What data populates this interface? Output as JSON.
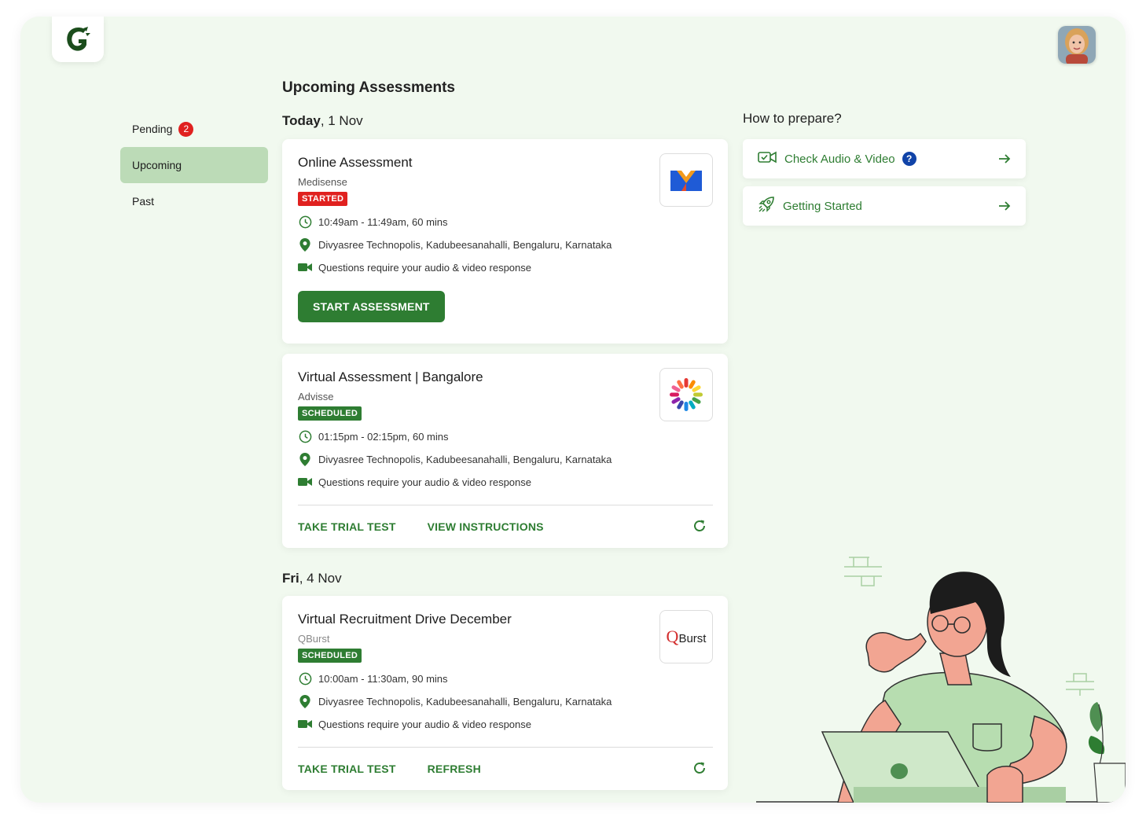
{
  "header": {
    "logo_icon": "crocodile-logo-icon",
    "avatar_icon": "user-avatar"
  },
  "sidebar": {
    "items": [
      {
        "label": "Pending",
        "badge": "2"
      },
      {
        "label": "Upcoming"
      },
      {
        "label": "Past"
      }
    ]
  },
  "main": {
    "title": "Upcoming Assessments",
    "groups": [
      {
        "day": "Today",
        "date": ", 1 Nov"
      },
      {
        "day": "Fri",
        "date": ", 4 Nov"
      }
    ],
    "cards": [
      {
        "title": "Online Assessment",
        "company": "Medisense",
        "status": "STARTED",
        "time": "10:49am - 11:49am, 60 mins",
        "location": "Divyasree Technopolis, Kadubeesanahalli, Bengaluru, Karnataka",
        "media": "Questions require your audio & video response",
        "action": "START ASSESSMENT"
      },
      {
        "title": "Virtual Assessment | Bangalore",
        "company": "Advisse",
        "status": "SCHEDULED",
        "time": "01:15pm - 02:15pm, 60 mins",
        "location": "Divyasree Technopolis, Kadubeesanahalli, Bengaluru, Karnataka",
        "media": "Questions require your audio & video response",
        "footer_links": [
          "TAKE TRIAL TEST",
          "VIEW INSTRUCTIONS"
        ]
      },
      {
        "title": "Virtual Recruitment Drive December",
        "company": "QBurst",
        "status": "SCHEDULED",
        "time": "10:00am - 11:30am, 90 mins",
        "location": "Divyasree Technopolis, Kadubeesanahalli, Bengaluru, Karnataka",
        "media": "Questions require your audio & video response",
        "footer_links": [
          "TAKE TRIAL TEST",
          "REFRESH"
        ],
        "logo_text": {
          "q": "Q",
          "rest": "Burst"
        }
      }
    ]
  },
  "prepare": {
    "title": "How to prepare?",
    "items": [
      {
        "label": "Check Audio & Video",
        "help": "?"
      },
      {
        "label": "Getting Started"
      }
    ]
  },
  "colors": {
    "brand_green": "#2e7d32",
    "active_bg": "#bcdbb7",
    "page_bg": "#f1f9ef",
    "started": "#e0211f",
    "help_blue": "#1043a8"
  }
}
